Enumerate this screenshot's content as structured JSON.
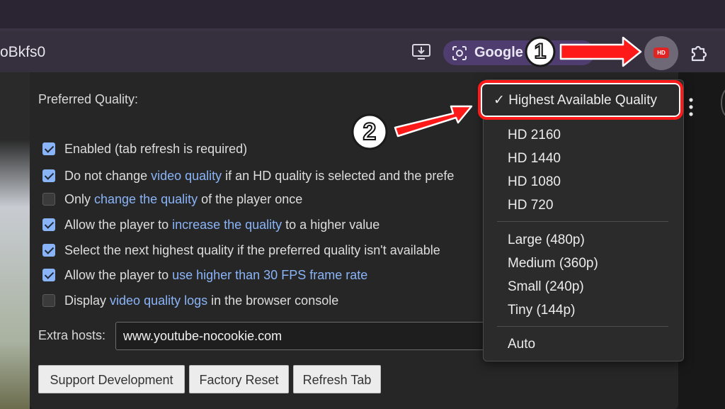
{
  "browser": {
    "url_fragment": "oBkfs0",
    "search_chip_label": "Google",
    "extension_badge": "HD"
  },
  "popup": {
    "preferred_quality_label": "Preferred Quality:",
    "options": [
      {
        "checked": true,
        "parts": [
          "Enabled (tab refresh is required)"
        ]
      },
      {
        "checked": true,
        "parts": [
          "Do not change ",
          "video quality",
          " if an HD quality is selected and the prefe"
        ]
      },
      {
        "checked": false,
        "parts": [
          "Only ",
          "change the quality",
          " of the player once"
        ]
      },
      {
        "checked": true,
        "parts": [
          "Allow the player to ",
          "increase the quality",
          " to a higher value"
        ]
      },
      {
        "checked": true,
        "parts": [
          "Select the next highest quality if the preferred quality isn't available"
        ]
      },
      {
        "checked": true,
        "parts": [
          "Allow the player to ",
          "use higher than 30 FPS frame rate"
        ]
      },
      {
        "checked": false,
        "parts": [
          "Display ",
          "video quality logs",
          " in the browser console"
        ]
      }
    ],
    "extra_hosts_label": "Extra hosts:",
    "extra_hosts_value": "www.youtube-nocookie.com",
    "buttons": {
      "support": "Support Development",
      "factory_reset": "Factory Reset",
      "refresh_tab": "Refresh Tab"
    }
  },
  "quality_dropdown": {
    "selected": "✓ Highest Available Quality",
    "group_hd": [
      "HD 2160",
      "HD 1440",
      "HD 1080",
      "HD 720"
    ],
    "group_sd": [
      "Large (480p)",
      "Medium (360p)",
      "Small (240p)",
      "Tiny (144p)"
    ],
    "auto": "Auto"
  },
  "annotations": {
    "step1": "1",
    "step2": "2",
    "accent_red": "#ff1a1a",
    "link_color": "#8ab4f8"
  }
}
